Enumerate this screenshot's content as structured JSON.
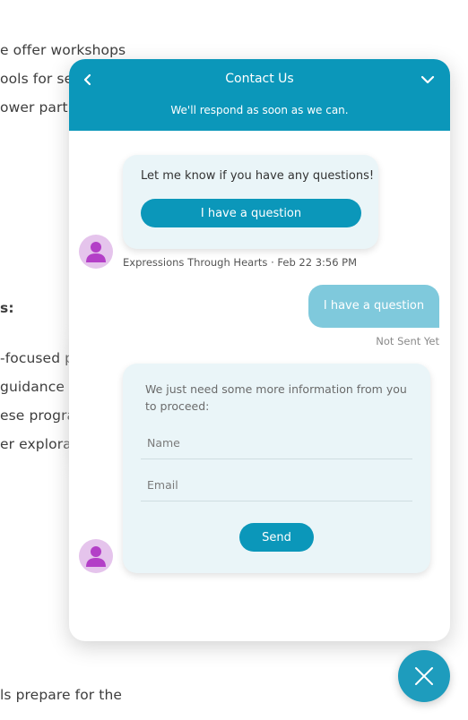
{
  "background_page": {
    "lines": [
      "e offer workshops",
      "ools for sel",
      "ower part",
      "s:",
      "-focused p",
      "guidance",
      "ese progra",
      "er explora",
      "ls prepare for the"
    ]
  },
  "chat": {
    "header": {
      "title": "Contact Us",
      "subtitle": "We'll respond as soon as we can.",
      "back_icon": "chevron-left-icon",
      "minimize_icon": "chevron-down-icon"
    },
    "messages": {
      "bot_greeting": {
        "text": "Let me know if you have any questions!",
        "button_label": "I have a question",
        "meta": "Expressions Through Hearts · Feb 22 3:56 PM"
      },
      "user_reply": {
        "text": "I have a question",
        "status": "Not Sent Yet"
      },
      "bot_form": {
        "text": "We just need some more information from you to proceed:",
        "name_placeholder": "Name",
        "email_placeholder": "Email",
        "send_label": "Send"
      }
    },
    "avatar_icon": "user-avatar-icon",
    "launcher_icon": "close-icon"
  },
  "colors": {
    "accent": "#0b97ba",
    "user_bubble": "#7fc9dc",
    "bot_bubble": "#eaf5f8",
    "avatar_bg": "#e5c4ec",
    "avatar_fg": "#b33fc7"
  }
}
